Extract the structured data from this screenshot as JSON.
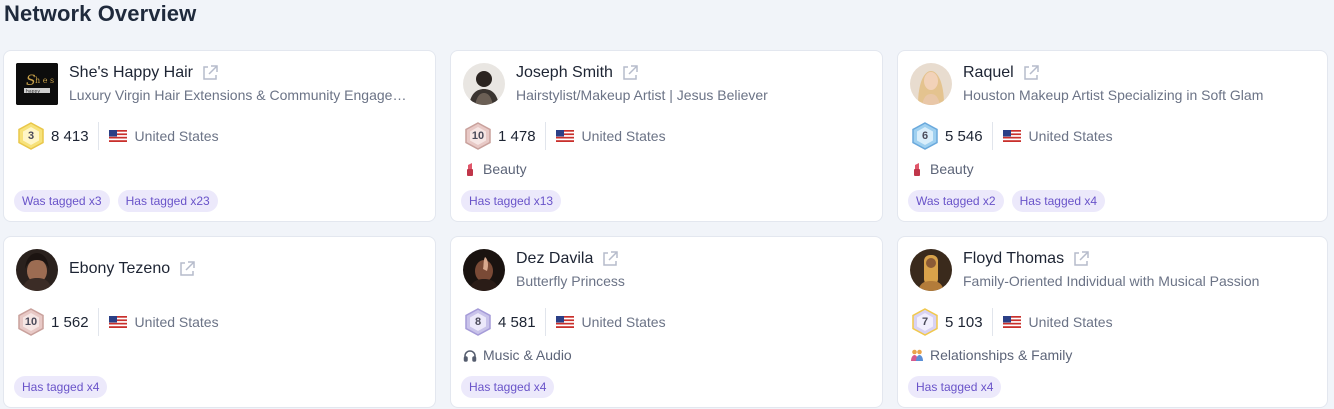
{
  "page": {
    "title": "Network Overview"
  },
  "colors": {
    "tag_bg": "#ece9fb",
    "tag_text": "#6953c9",
    "card_border": "#e3e7ef"
  },
  "cards": [
    {
      "name": "She's Happy Hair",
      "subtitle": "Luxury Virgin Hair Extensions & Community Engage…",
      "rank": "3",
      "count": "8 413",
      "country": "United States",
      "category": "",
      "tags": [
        "Was tagged x3",
        "Has tagged x23"
      ]
    },
    {
      "name": "Joseph Smith",
      "subtitle": "Hairstylist/Makeup Artist | Jesus Believer",
      "rank": "10",
      "count": "1 478",
      "country": "United States",
      "category": "Beauty",
      "category_icon": "lipstick-icon",
      "tags": [
        "Has tagged x13"
      ]
    },
    {
      "name": "Raquel",
      "subtitle": "Houston Makeup Artist Specializing in Soft Glam",
      "rank": "6",
      "count": "5 546",
      "country": "United States",
      "category": "Beauty",
      "category_icon": "lipstick-icon",
      "tags": [
        "Was tagged x2",
        "Has tagged x4"
      ]
    },
    {
      "name": "Ebony Tezeno",
      "subtitle": "",
      "rank": "10",
      "count": "1 562",
      "country": "United States",
      "category": "",
      "tags": [
        "Has tagged x4"
      ]
    },
    {
      "name": "Dez Davila",
      "subtitle": "Butterfly Princess",
      "rank": "8",
      "count": "4 581",
      "country": "United States",
      "category": "Music & Audio",
      "category_icon": "headphones-icon",
      "tags": [
        "Has tagged x4"
      ]
    },
    {
      "name": "Floyd Thomas",
      "subtitle": "Family-Oriented Individual with Musical Passion",
      "rank": "7",
      "count": "5 103",
      "country": "United States",
      "category": "Relationships & Family",
      "category_icon": "couple-icon",
      "tags": [
        "Has tagged x4"
      ]
    }
  ],
  "icons": {
    "external_link": "external-link-icon",
    "flag": "us-flag-icon"
  }
}
